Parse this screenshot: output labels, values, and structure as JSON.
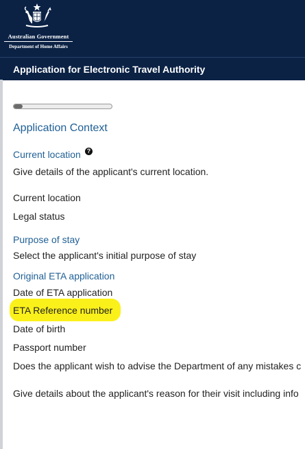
{
  "header": {
    "government_name": "Australian Government",
    "department_name": "Department of Home Affairs",
    "crest_icon": "coat-of-arms-icon",
    "background_color": "#0b2245"
  },
  "title_bar": {
    "title": "Application for Electronic Travel Authority"
  },
  "progress": {
    "fraction": 0.09
  },
  "main": {
    "section_title": "Application Context",
    "current_location_heading": "Current location",
    "help_icon": "question-circle-icon",
    "current_location_desc": "Give details of the applicant's current location.",
    "current_location_field": "Current location",
    "legal_status_field": "Legal status",
    "purpose_heading": "Purpose of stay",
    "purpose_desc": "Select the applicant's initial purpose of stay",
    "original_eta_heading": "Original ETA application",
    "date_of_eta_field": "Date of ETA application",
    "eta_reference_field": "ETA Reference number",
    "date_of_birth_field": "Date of birth",
    "passport_number_field": "Passport number",
    "mistakes_question": "Does the applicant wish to advise the Department of any mistakes c",
    "reason_desc": "Give details about the applicant's reason for their visit including info"
  },
  "colors": {
    "heading_blue": "#1f5f95",
    "highlight": "#fbf11a"
  }
}
